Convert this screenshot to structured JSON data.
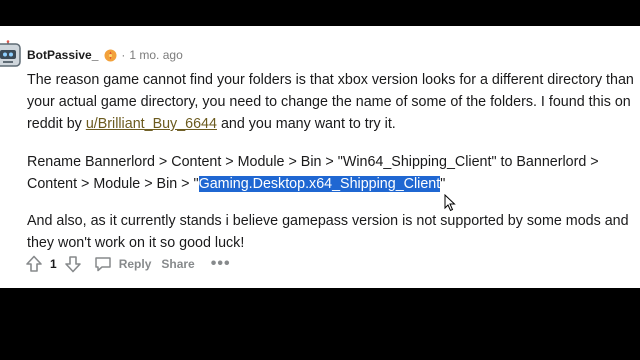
{
  "comment": {
    "author": "BotPassive_",
    "separator": "·",
    "timestamp": "1 mo. ago",
    "body": {
      "p1_line1": "The reason game cannot find your folders is that xbox version looks for a different directory than",
      "p1_line2": "your actual game directory, you need to change the name of some of the folders. I found this on",
      "p1_line3_prefix": "reddit by ",
      "p1_link": "u/Brilliant_Buy_6644",
      "p1_line3_suffix": " and you many want to try it.",
      "p2_line1": "Rename Bannerlord > Content > Module > Bin > \"Win64_Shipping_Client\" to Bannerlord >",
      "p2_line2_prefix": "Content > Module > Bin > \"",
      "p2_highlight": "Gaming.Desktop.x64_Shipping_Client",
      "p2_line2_suffix": "\"",
      "p3_line1": "And also, as it currently stands i believe gamepass version is not supported by some mods and",
      "p3_line2": "they won't work on it so good luck!"
    },
    "actions": {
      "score": "1",
      "reply_label": "Reply",
      "share_label": "Share",
      "more_label": "•••"
    }
  },
  "colors": {
    "link": "#6b5a1e",
    "selection": "#1f67d2",
    "muted": "#878a8c"
  }
}
